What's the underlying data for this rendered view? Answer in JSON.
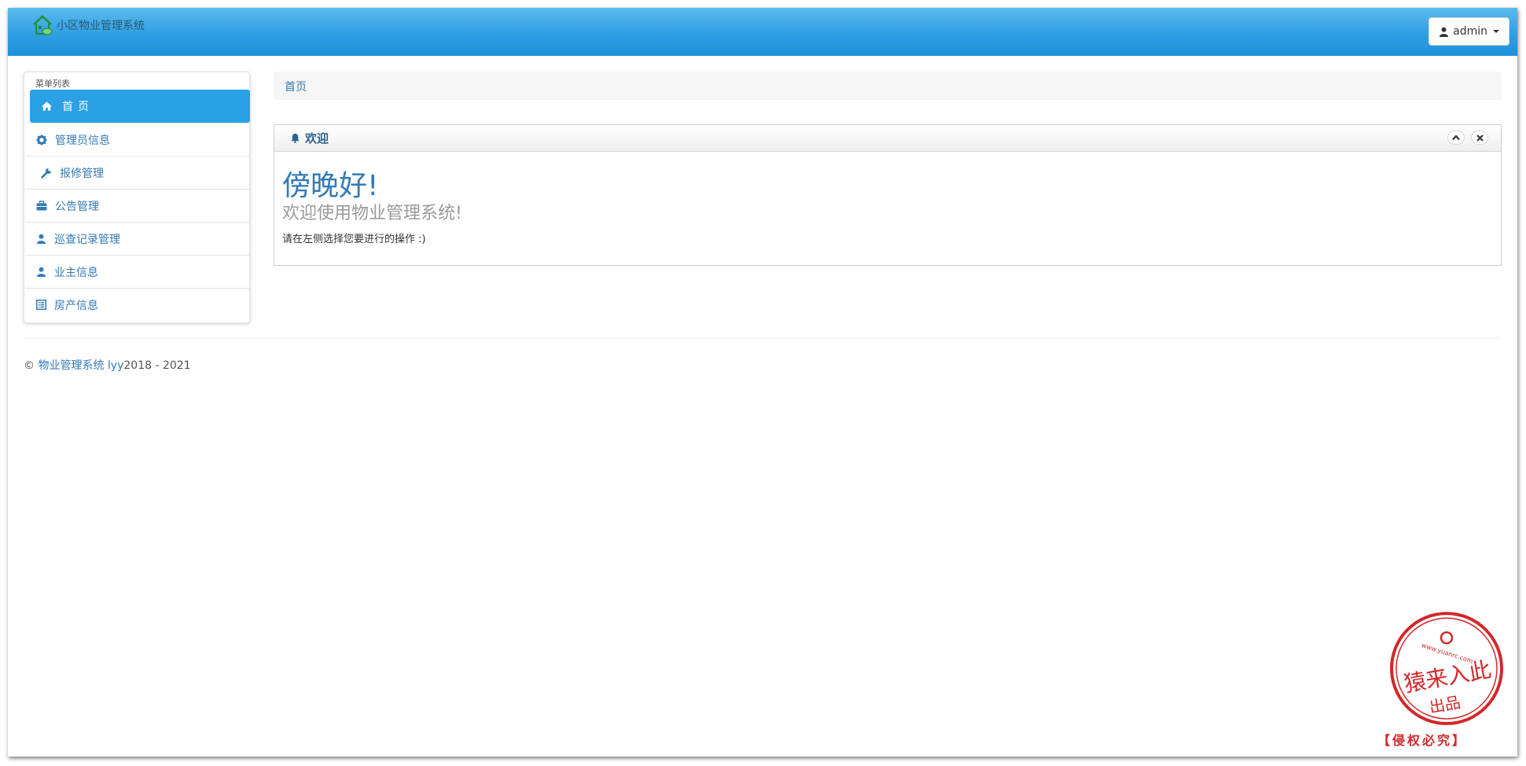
{
  "app": {
    "title": "小区物业管理系统",
    "user_label": "admin"
  },
  "sidebar": {
    "header": "菜单列表",
    "items": [
      {
        "label": "首页",
        "icon": "home-icon",
        "active": true
      },
      {
        "label": "管理员信息",
        "icon": "gear-icon"
      },
      {
        "label": "报修管理",
        "icon": "wrench-icon"
      },
      {
        "label": "公告管理",
        "icon": "briefcase-icon"
      },
      {
        "label": "巡查记录管理",
        "icon": "user-icon"
      },
      {
        "label": "业主信息",
        "icon": "user-icon"
      },
      {
        "label": "房产信息",
        "icon": "list-alt-icon"
      }
    ]
  },
  "breadcrumb": {
    "home": "首页"
  },
  "welcome_panel": {
    "title": "欢迎",
    "greeting": "傍晚好!",
    "welcome": "欢迎使用物业管理系统!",
    "instruction": "请在左侧选择您要进行的操作 :)"
  },
  "footer": {
    "copyright_symbol": "©",
    "link_text": "物业管理系统 lyy",
    "years": "2018 - 2021"
  },
  "watermark": {
    "stamp_text": "猿来入此",
    "stamp_sub": "出品",
    "stamp_url": "www.yuanrc.com",
    "caption": "【侵权必究】"
  },
  "colors": {
    "navbar": "#2f9fe3",
    "active_menu": "#29a1e4",
    "link": "#337ab7",
    "stamp": "#d2282a"
  }
}
